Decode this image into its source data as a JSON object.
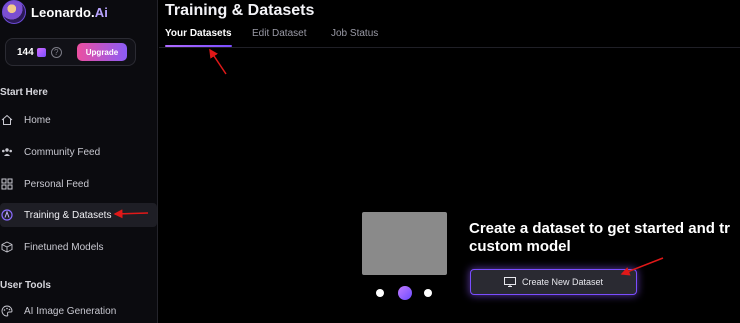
{
  "brand": {
    "name": "Leonardo.",
    "accent": "Ai"
  },
  "credits": {
    "count": "144",
    "upgrade_label": "Upgrade"
  },
  "sidebar": {
    "section_start": "Start Here",
    "items": [
      {
        "label": "Home",
        "icon": "home-icon"
      },
      {
        "label": "Community Feed",
        "icon": "community-icon"
      },
      {
        "label": "Personal Feed",
        "icon": "grid-icon"
      },
      {
        "label": "Training & Datasets",
        "icon": "training-icon",
        "active": true
      },
      {
        "label": "Finetuned Models",
        "icon": "cube-icon"
      }
    ],
    "section_tools": "User Tools",
    "tools": [
      {
        "label": "AI Image Generation",
        "icon": "palette-icon"
      }
    ]
  },
  "main": {
    "title": "Training & Datasets",
    "tabs": [
      {
        "label": "Your Datasets",
        "active": true
      },
      {
        "label": "Edit Dataset"
      },
      {
        "label": "Job Status"
      }
    ],
    "cta_line1": "Create a dataset to get started and tr",
    "cta_line2": "custom model",
    "create_button": "Create New Dataset"
  },
  "colors": {
    "accent": "#7a4dff",
    "annotation_arrow": "#e01818",
    "background": "#000000"
  }
}
